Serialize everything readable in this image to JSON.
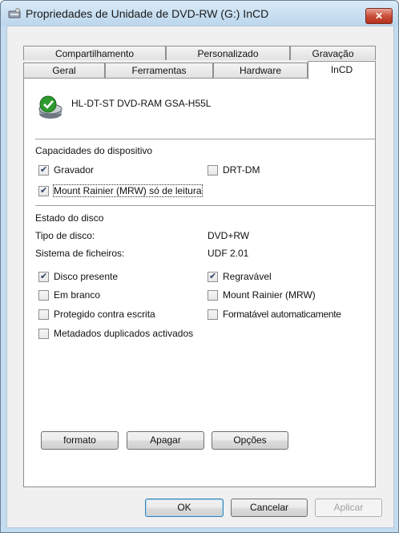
{
  "window": {
    "title": "Propriedades de Unidade de DVD-RW (G:) InCD",
    "close_symbol": "✕"
  },
  "tabs": {
    "row1": [
      "Compartilhamento",
      "Personalizado",
      "Gravação"
    ],
    "row2": [
      "Geral",
      "Ferramentas",
      "Hardware",
      "InCD"
    ],
    "active": "InCD"
  },
  "device": {
    "icon": "drive-ok-icon",
    "name": "HL-DT-ST DVD-RAM GSA-H55L"
  },
  "capabilities": {
    "heading": "Capacidades do dispositivo",
    "gravador": {
      "label": "Gravador",
      "checked": true
    },
    "drt_dm": {
      "label": "DRT-DM",
      "checked": false
    },
    "mount_rainier_readonly": {
      "label": "Mount Rainier (MRW) só de leitura",
      "checked": true
    }
  },
  "disc_state": {
    "heading": "Estado do disco",
    "disc_type_label": "Tipo de disco:",
    "disc_type_value": "DVD+RW",
    "filesystem_label": "Sistema de ficheiros:",
    "filesystem_value": "UDF 2.01",
    "checks": {
      "disco_presente": {
        "label": "Disco presente",
        "checked": true
      },
      "regravavel": {
        "label": "Regravável",
        "checked": true
      },
      "em_branco": {
        "label": "Em branco",
        "checked": false
      },
      "mount_rainier": {
        "label": "Mount Rainier (MRW)",
        "checked": false
      },
      "protegido": {
        "label": "Protegido contra escrita",
        "checked": false
      },
      "formatavel": {
        "label": "Formatável automaticamente",
        "checked": false
      },
      "metadados": {
        "label": "Metadados duplicados activados",
        "checked": false
      }
    }
  },
  "panel_buttons": {
    "formato": "formato",
    "apagar": "Apagar",
    "opcoes": "Opções"
  },
  "dialog_buttons": {
    "ok": "OK",
    "cancel": "Cancelar",
    "apply": "Aplicar"
  }
}
